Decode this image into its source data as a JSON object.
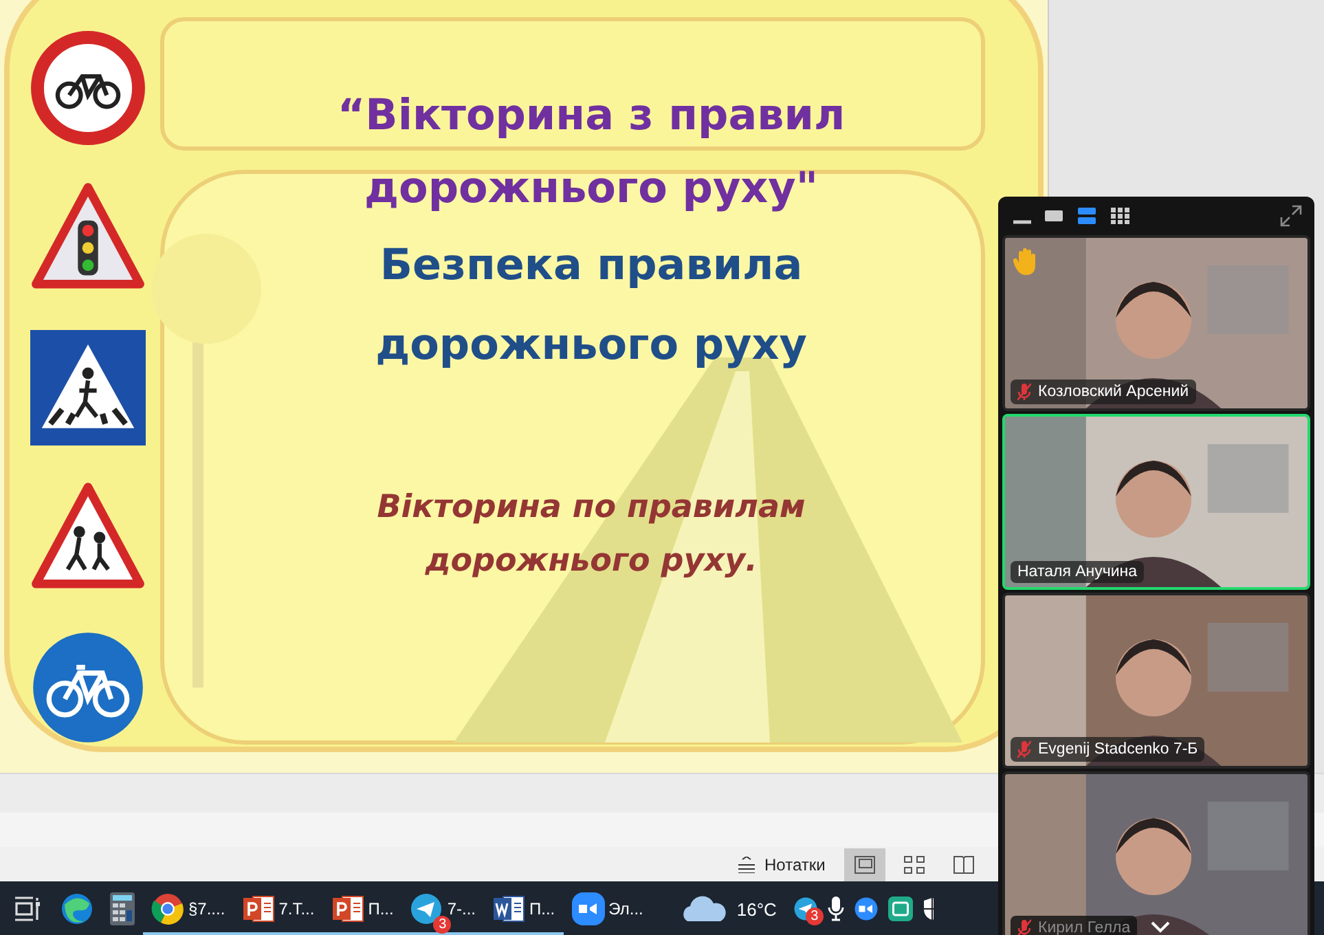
{
  "slide": {
    "title": "“Вікторина з правил дорожнього руху\"",
    "subtitle": "Безпека правила дорожнього руху",
    "caption": "Вікторина по правилам дорожнього руху.",
    "signs": [
      {
        "kind": "no-bicycle"
      },
      {
        "kind": "traffic-light"
      },
      {
        "kind": "crosswalk"
      },
      {
        "kind": "children"
      },
      {
        "kind": "bicycle-path"
      }
    ]
  },
  "status_bar": {
    "notes": "Нотатки",
    "views": [
      {
        "kind": "normal",
        "selected": true
      },
      {
        "kind": "sorter",
        "selected": false
      },
      {
        "kind": "reading",
        "selected": false
      }
    ]
  },
  "meeting": {
    "views": [
      {
        "kind": "minimize",
        "selected": false
      },
      {
        "kind": "single",
        "selected": false
      },
      {
        "kind": "speaker",
        "selected": true
      },
      {
        "kind": "gallery",
        "selected": false
      }
    ],
    "participants": [
      {
        "name": "Козловский Арсений",
        "muted": true,
        "hand_raised": true,
        "speaking": false,
        "dimmed": false
      },
      {
        "name": "Наталя Анучина",
        "muted": false,
        "hand_raised": false,
        "speaking": true,
        "dimmed": false
      },
      {
        "name": "Evgenij Stadcenko 7-Б",
        "muted": true,
        "hand_raised": false,
        "speaking": false,
        "dimmed": false
      },
      {
        "name": "Кирил Гелла",
        "muted": true,
        "hand_raised": false,
        "speaking": false,
        "dimmed": true
      }
    ]
  },
  "taskbar": {
    "apps": [
      {
        "kind": "task-view",
        "running": false
      },
      {
        "kind": "edge",
        "running": false
      },
      {
        "kind": "calculator",
        "running": false
      },
      {
        "kind": "chrome",
        "label": "§7....",
        "running": true
      },
      {
        "kind": "powerpoint",
        "label": "7.T...",
        "running": true
      },
      {
        "kind": "powerpoint",
        "label": "П...",
        "running": true
      },
      {
        "kind": "telegram",
        "label": "7-...",
        "running": true,
        "badge": "3"
      },
      {
        "kind": "word",
        "label": "П...",
        "running": true
      },
      {
        "kind": "zoom",
        "label": "Эл...",
        "running": false
      }
    ],
    "weather": "16°C",
    "tray": [
      {
        "kind": "telegram",
        "badge": "3"
      },
      {
        "kind": "mic"
      },
      {
        "kind": "zoom"
      },
      {
        "kind": "green-app"
      },
      {
        "kind": "shield"
      }
    ]
  }
}
